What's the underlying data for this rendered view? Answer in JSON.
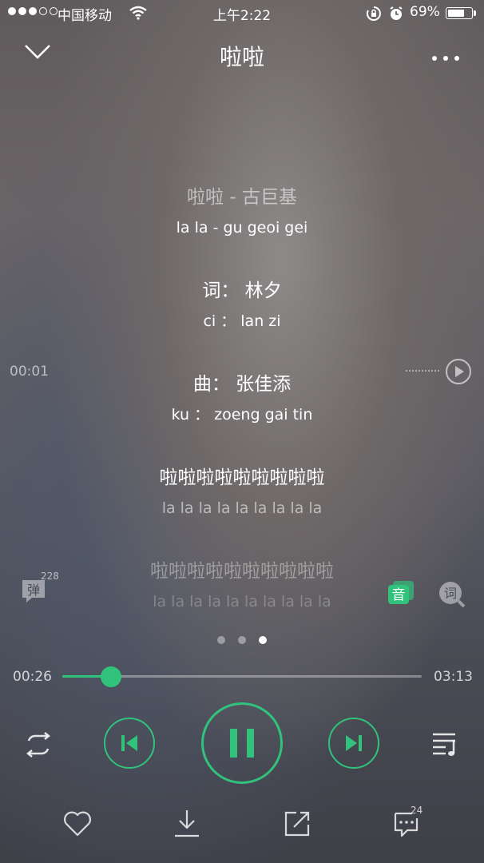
{
  "status_bar": {
    "carrier": "中国移动",
    "time": "上午2:22",
    "battery": "69%",
    "signal_bars_filled": 3,
    "signal_bars_total": 5,
    "battery_level": 0.69
  },
  "header": {
    "title": "啦啦"
  },
  "lyrics": [
    {
      "main": "啦啦 - 古巨基",
      "sub": "la la  - gu geoi gei"
    },
    {
      "main": "词：  林夕",
      "sub": "ci ：  lan zi"
    },
    {
      "main": "曲：  张佳添",
      "sub": "ku ：  zoeng gai tin"
    },
    {
      "main": "啦啦啦啦啦啦啦啦啦",
      "sub": "la la la la la la la la la"
    },
    {
      "main": "啦啦啦啦啦啦啦啦啦啦",
      "sub": "la la la la la la la la la la"
    }
  ],
  "lyric_seek_time": "00:01",
  "side": {
    "danmu_label": "弹",
    "danmu_count": "228",
    "sound_label": "音",
    "lyric_label": "词"
  },
  "pager": {
    "count": 3,
    "active": 2
  },
  "progress": {
    "current": "00:26",
    "total": "03:13",
    "fraction": 0.1347
  },
  "bottom": {
    "comment_count": "24"
  },
  "colors": {
    "accent": "#31c27c"
  },
  "icons": [
    "chevron-down-icon",
    "more-icon",
    "play-icon",
    "repeat-icon",
    "previous-icon",
    "pause-icon",
    "next-icon",
    "playlist-icon",
    "heart-icon",
    "download-icon",
    "share-icon",
    "comment-icon"
  ]
}
